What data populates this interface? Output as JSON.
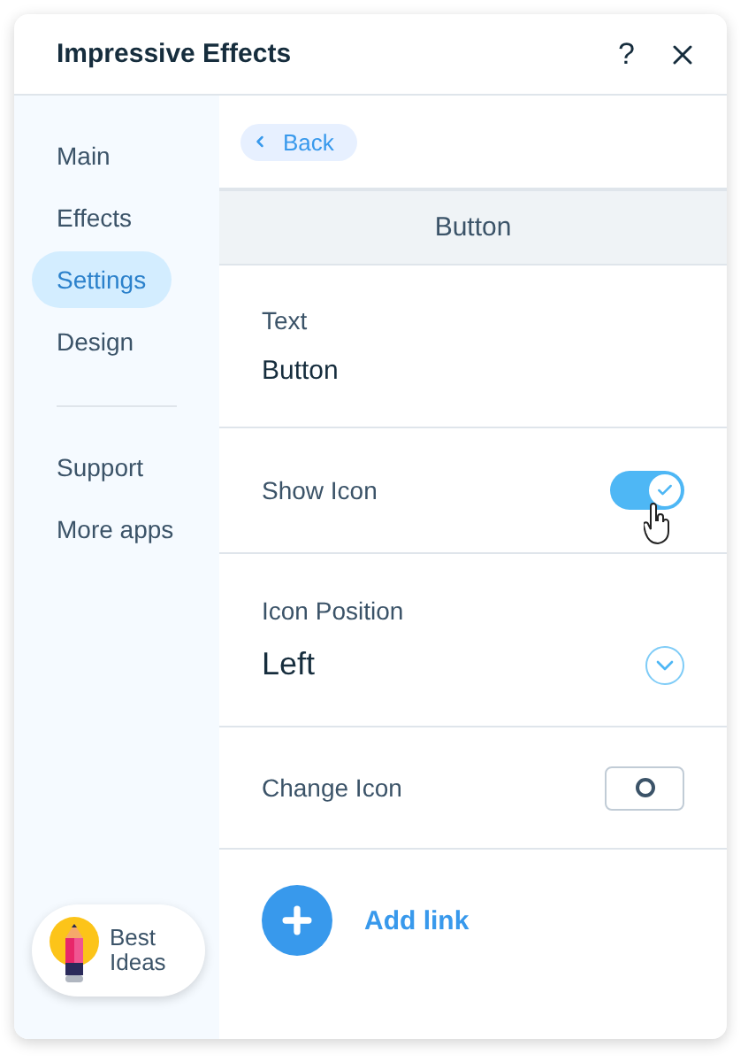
{
  "window": {
    "title": "Impressive Effects",
    "help": "?"
  },
  "sidebar": {
    "groups": [
      {
        "items": [
          {
            "label": "Main",
            "selected": false
          },
          {
            "label": "Effects",
            "selected": false
          },
          {
            "label": "Settings",
            "selected": true
          },
          {
            "label": "Design",
            "selected": false
          }
        ]
      },
      {
        "items": [
          {
            "label": "Support",
            "selected": false
          },
          {
            "label": "More apps",
            "selected": false
          }
        ]
      }
    ],
    "badge": {
      "label": "Best Ideas"
    }
  },
  "content": {
    "back": "Back",
    "header": "Button",
    "rows": [
      {
        "kind": "text",
        "label": "Text",
        "value": "Button"
      },
      {
        "kind": "toggle",
        "label": "Show Icon",
        "on": true
      },
      {
        "kind": "dropdown",
        "label": "Icon Position",
        "value": "Left"
      },
      {
        "kind": "icon_picker",
        "label": "Change Icon"
      }
    ],
    "add_link": "Add link"
  }
}
